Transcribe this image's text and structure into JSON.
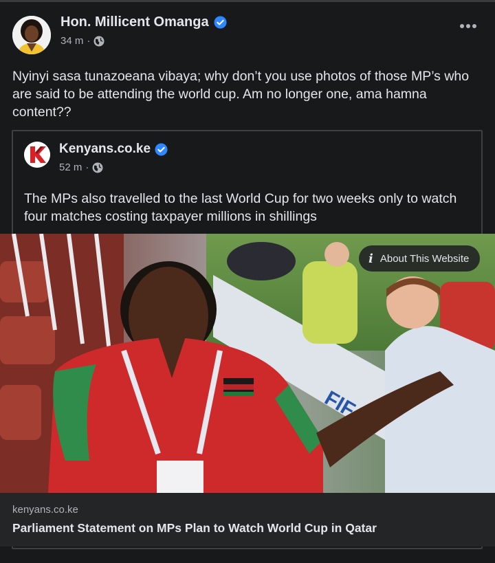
{
  "post": {
    "author": "Hon. Millicent Omanga",
    "time": "34 m",
    "time_separator": "·",
    "text": "Nyinyi sasa tunazoeana vibaya; why don’t you use photos of those MP’s who are said to be attending the world cup. Am no longer one, ama hamna content??",
    "more_icon": "more-horizontal-icon",
    "privacy_icon": "globe-icon"
  },
  "shared_post": {
    "author": "Kenyans.co.ke",
    "time": "52 m",
    "time_separator": "·",
    "text": "The MPs also travelled to the last World Cup for two weeks only to watch four matches costing taxpayer millions in shillings",
    "logo_letter": "K"
  },
  "link_preview": {
    "about_label": "About This Website",
    "domain": "kenyans.co.ke",
    "headline": "Parliament Statement on MPs Plan to Watch World Cup in Qatar"
  },
  "colors": {
    "background": "#18191a",
    "card": "#242526",
    "verified": "#2d88ff",
    "brand_red": "#d92128"
  }
}
